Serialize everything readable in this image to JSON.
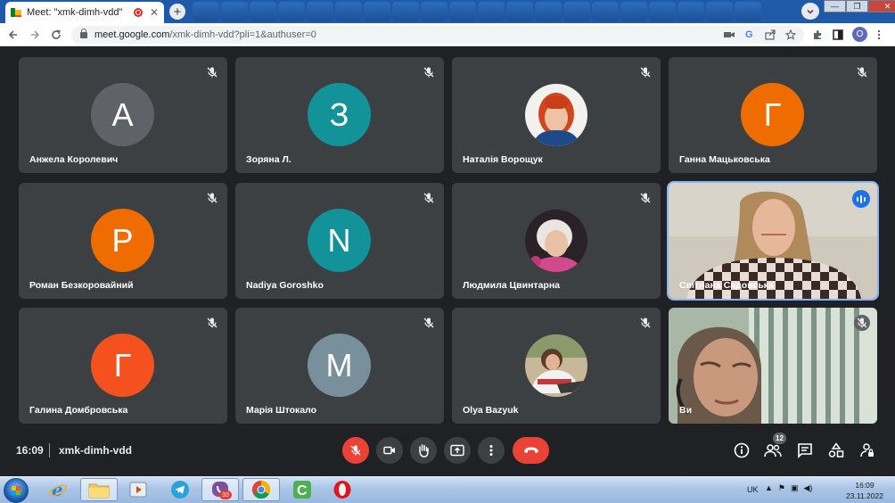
{
  "browser": {
    "tab_title": "Meet: \"xmk-dimh-vdd\"",
    "tab_close": "✕",
    "new_tab": "+",
    "url_host": "meet.google.com",
    "url_path": "/xmk-dimh-vdd?pli=1&authuser=0",
    "profile_initial": "O",
    "window_controls": {
      "minimize": "—",
      "maximize": "❐",
      "close": "✕"
    }
  },
  "participants": [
    {
      "name": "Анжела Королевич",
      "initial": "А",
      "avatar_color": "#5f6368",
      "type": "avatar",
      "muted": true
    },
    {
      "name": "Зоряна Л.",
      "initial": "З",
      "avatar_color": "#12939a",
      "type": "avatar",
      "muted": true
    },
    {
      "name": "Наталія Ворощук",
      "type": "photo",
      "muted": true
    },
    {
      "name": "Ганна Мацьковська",
      "initial": "Г",
      "avatar_color": "#ef6c00",
      "type": "avatar",
      "muted": true
    },
    {
      "name": "Роман Безкоровайний",
      "initial": "Р",
      "avatar_color": "#ef6c00",
      "type": "avatar",
      "muted": true
    },
    {
      "name": "Nadiya Goroshko",
      "initial": "N",
      "avatar_color": "#12939a",
      "type": "avatar",
      "muted": true
    },
    {
      "name": "Людмила Цвинтарна",
      "type": "photo",
      "muted": true
    },
    {
      "name": "Світлана Садовська",
      "type": "video",
      "speaking": true
    },
    {
      "name": "Галина Домбровська",
      "initial": "Г",
      "avatar_color": "#f4511e",
      "type": "avatar",
      "muted": true
    },
    {
      "name": "Марія Штокало",
      "initial": "М",
      "avatar_color": "#78909c",
      "type": "avatar",
      "muted": true
    },
    {
      "name": "Olya Bazyuk",
      "type": "photo",
      "muted": true
    },
    {
      "name": "Ви",
      "type": "video",
      "muted": true
    }
  ],
  "meeting": {
    "time": "16:09",
    "code": "xmk-dimh-vdd",
    "participant_count": "12"
  },
  "taskbar": {
    "viber_badge": "33",
    "language": "UK",
    "clock_time": "16:09",
    "clock_date": "23.11.2022"
  },
  "colors": {
    "meet_background": "#202124",
    "tile_background": "#3c4043",
    "danger_red": "#ea4335",
    "speaking_blue": "#1a73e8"
  }
}
